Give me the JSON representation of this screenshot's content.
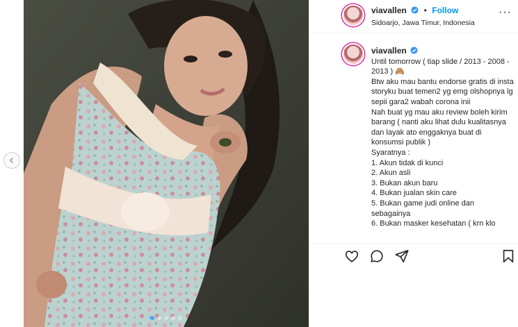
{
  "post": {
    "username": "viavallen",
    "follow_label": "Follow",
    "separator": "•",
    "location": "Sidoarjo, Jawa Timur, Indonesia",
    "more_label": "···",
    "carousel": {
      "total": 5,
      "active": 1
    }
  },
  "caption": {
    "username": "viavallen",
    "lines": [
      "Until tomorrow ( tiap slide / 2013 - 2008 - 2013 ) 🙈",
      "Btw aku mau bantu endorse gratis di insta storyku buat temen2 yg emg olshopnya lg sepii gara2 wabah corona inii",
      "Nah buat yg mau aku review boleh kirim barang ( nanti aku lihat dulu kualitasnya dan layak ato enggaknya buat di konsumsi publik )",
      "Syaratnya :",
      "1. Akun tidak di kunci",
      "2. Akun asli",
      "3. Bukan akun baru",
      "4. Bukan jualan skin care",
      "5. Bukan game judi online dan sebagainya",
      "6. Bukan masker kesehatan ( krn klo"
    ]
  },
  "icons": {
    "verified": "verified-badge-icon",
    "like": "heart-icon",
    "comment": "comment-icon",
    "share": "share-icon",
    "save": "bookmark-icon",
    "prev": "chevron-left-icon"
  },
  "colors": {
    "follow": "#0095f6",
    "verified": "#3897f0",
    "active_dot": "#4aa3ff"
  }
}
